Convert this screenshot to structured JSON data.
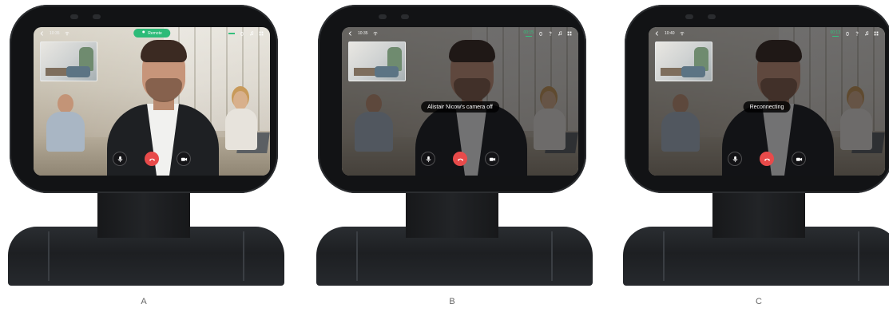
{
  "panels": [
    {
      "caption": "A",
      "status_time": "10:35",
      "call_timer": "",
      "pill_label": "Remote",
      "toast": "",
      "dimmed": false
    },
    {
      "caption": "B",
      "status_time": "10:35",
      "call_timer": "00:15",
      "pill_label": "",
      "toast": "Alistair Nicow's camera off",
      "dimmed": true
    },
    {
      "caption": "C",
      "status_time": "10:40",
      "call_timer": "00:13",
      "pill_label": "",
      "toast": "Reconnecting",
      "dimmed": true
    }
  ],
  "controls": {
    "mic_icon": "microphone-icon",
    "end_icon": "end-call-icon",
    "camera_icon": "video-camera-icon"
  },
  "colors": {
    "accent_green": "#2dbb78",
    "end_call_red": "#e84a4a"
  }
}
